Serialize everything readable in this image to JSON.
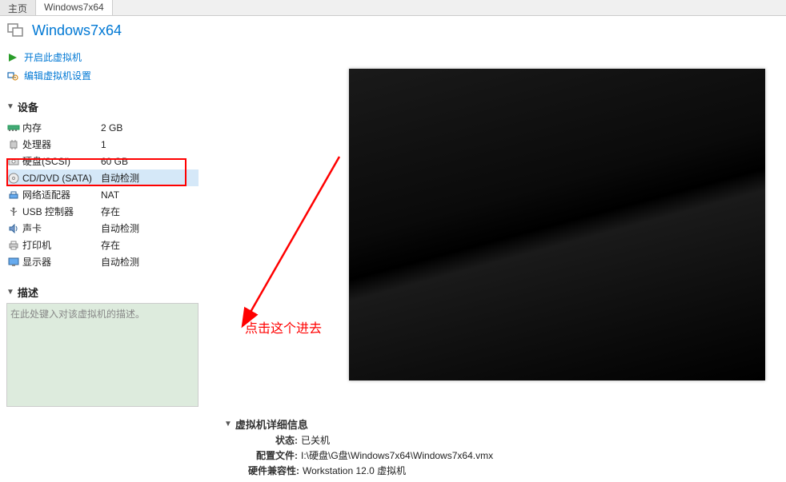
{
  "tabs": {
    "home": "主页",
    "vm": "Windows7x64"
  },
  "vmTitle": "Windows7x64",
  "actions": {
    "powerOn": "开启此虚拟机",
    "editSettings": "编辑虚拟机设置"
  },
  "sections": {
    "devices": "设备",
    "description": "描述",
    "details": "虚拟机详细信息"
  },
  "devices": [
    {
      "name": "内存",
      "value": "2 GB"
    },
    {
      "name": "处理器",
      "value": "1"
    },
    {
      "name": "硬盘(SCSI)",
      "value": "60 GB"
    },
    {
      "name": "CD/DVD (SATA)",
      "value": "自动检测"
    },
    {
      "name": "网络适配器",
      "value": "NAT"
    },
    {
      "name": "USB 控制器",
      "value": "存在"
    },
    {
      "name": "声卡",
      "value": "自动检测"
    },
    {
      "name": "打印机",
      "value": "存在"
    },
    {
      "name": "显示器",
      "value": "自动检测"
    }
  ],
  "descriptionPlaceholder": "在此处键入对该虚拟机的描述。",
  "annotation": "点击这个进去",
  "details": {
    "stateLabel": "状态:",
    "stateValue": "已关机",
    "configLabel": "配置文件:",
    "configValue": "I:\\硬盘\\G盘\\Windows7x64\\Windows7x64.vmx",
    "compatLabel": "硬件兼容性:",
    "compatValue": "Workstation 12.0 虚拟机"
  }
}
